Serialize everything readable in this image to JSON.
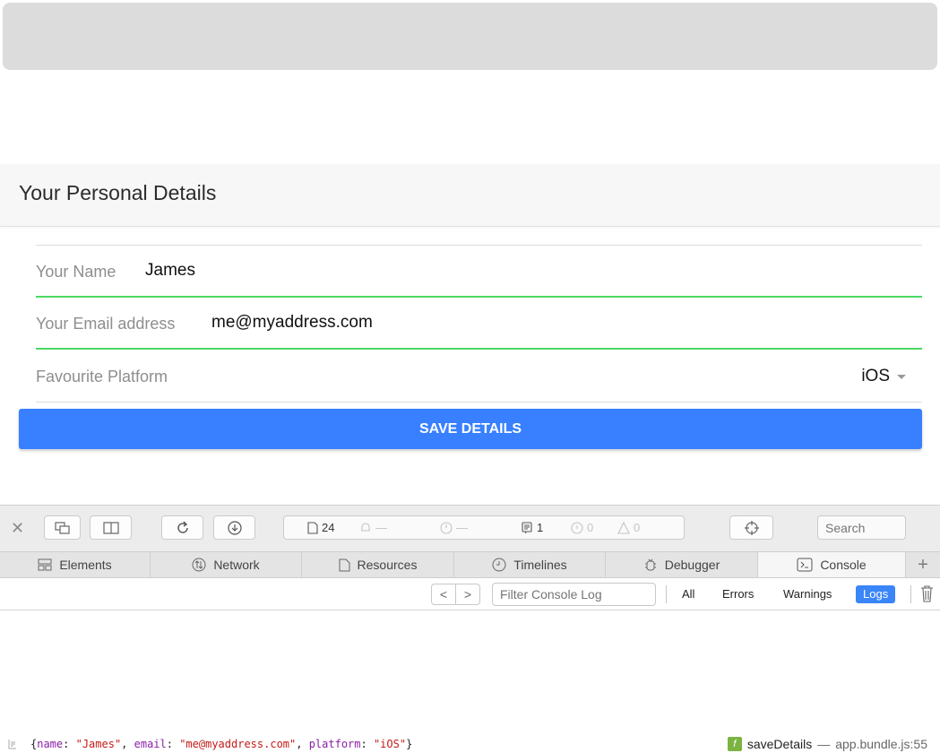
{
  "card": {
    "title": "Your Personal Details"
  },
  "form": {
    "name": {
      "label": "Your Name",
      "value": "James"
    },
    "email": {
      "label": "Your Email address",
      "value": "me@myaddress.com"
    },
    "platform": {
      "label": "Favourite Platform",
      "value": "iOS"
    },
    "save_label": "SAVE DETAILS"
  },
  "colors": {
    "accent": "#3880ff",
    "valid": "#4cd964",
    "active_filter": "#3a85f7"
  },
  "devtools": {
    "resources_count": "24",
    "dash1": "—",
    "dash2": "—",
    "log_count": "1",
    "error_count": "0",
    "warning_count": "0",
    "search_placeholder": "Search",
    "tabs": [
      {
        "label": "Elements",
        "icon": "elements-icon"
      },
      {
        "label": "Network",
        "icon": "network-icon"
      },
      {
        "label": "Resources",
        "icon": "resources-icon"
      },
      {
        "label": "Timelines",
        "icon": "timelines-icon"
      },
      {
        "label": "Debugger",
        "icon": "debugger-icon"
      },
      {
        "label": "Console",
        "icon": "console-icon"
      }
    ],
    "filter_placeholder": "Filter Console Log",
    "filters": {
      "all": "All",
      "errors": "Errors",
      "warnings": "Warnings",
      "logs": "Logs"
    },
    "active_filter": "Logs"
  },
  "console": {
    "entry": {
      "name_key": "name",
      "name_val": "\"James\"",
      "email_key": "email",
      "email_val": "\"me@myaddress.com\"",
      "platform_key": "platform",
      "platform_val": "\"iOS\""
    },
    "source_fn": "saveDetails",
    "source_sep": "—",
    "source_file": "app.bundle.js:55"
  }
}
